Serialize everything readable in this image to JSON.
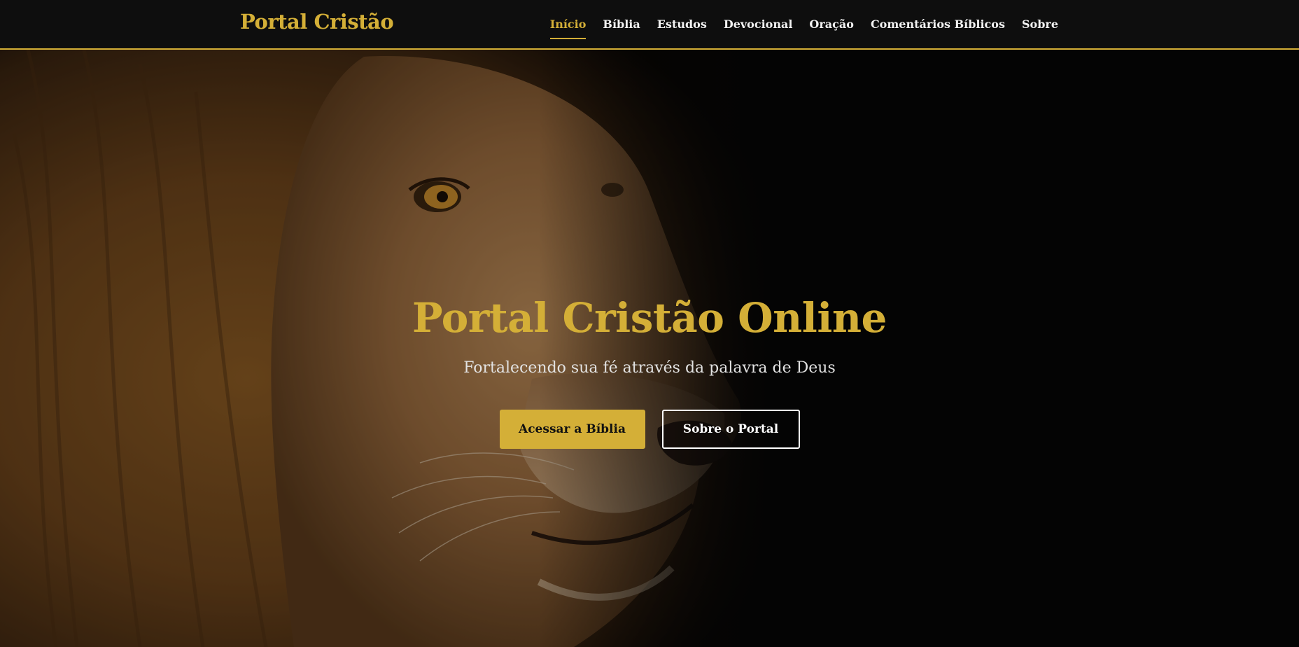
{
  "header": {
    "brand": "Portal Cristão",
    "nav": [
      {
        "label": "Início",
        "active": true
      },
      {
        "label": "Bíblia",
        "active": false
      },
      {
        "label": "Estudos",
        "active": false
      },
      {
        "label": "Devocional",
        "active": false
      },
      {
        "label": "Oração",
        "active": false
      },
      {
        "label": "Comentários Bíblicos",
        "active": false
      },
      {
        "label": "Sobre",
        "active": false
      }
    ]
  },
  "hero": {
    "background_image": "lion-portrait",
    "title": "Portal Cristão Online",
    "subtitle": "Fortalecendo sua fé através da palavra de Deus",
    "primary_button": "Acessar a Bíblia",
    "secondary_button": "Sobre o Portal"
  },
  "colors": {
    "accent": "#d4af37",
    "background": "#050505",
    "navbar": "#0e0e0e",
    "text_light": "#f2f2f2"
  }
}
